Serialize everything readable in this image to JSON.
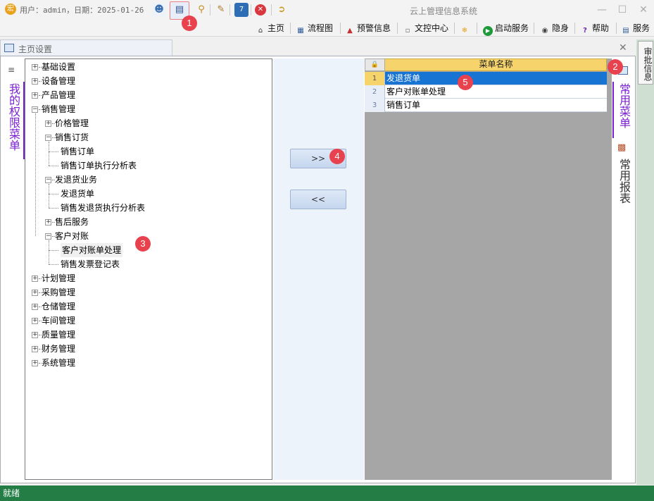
{
  "titlebar": {
    "user_info": "用户：admin，日期：2025-01-26",
    "app_title": "云上管理信息系统",
    "icon_glyph": "宏"
  },
  "navbar": {
    "items": [
      {
        "label": "主页",
        "icon": "home-icon"
      },
      {
        "label": "流程图",
        "icon": "flowchart-icon"
      },
      {
        "label": "预警信息",
        "icon": "warning-icon"
      },
      {
        "label": "文控中心",
        "icon": "document-center-icon"
      },
      {
        "label": "",
        "icon": "color-logo-icon"
      },
      {
        "label": "启动服务",
        "icon": "play-icon"
      },
      {
        "label": "隐身",
        "icon": "incognito-icon"
      },
      {
        "label": "帮助",
        "icon": "help-icon"
      },
      {
        "label": "服务",
        "icon": "service-icon"
      }
    ]
  },
  "panel": {
    "title": "主页设置"
  },
  "left_tab": {
    "label": "我的权限菜单"
  },
  "tree": {
    "nodes": [
      {
        "label": "基础设置",
        "level": 0,
        "state": "collapsed"
      },
      {
        "label": "设备管理",
        "level": 0,
        "state": "collapsed"
      },
      {
        "label": "产品管理",
        "level": 0,
        "state": "collapsed"
      },
      {
        "label": "销售管理",
        "level": 0,
        "state": "expanded"
      },
      {
        "label": "价格管理",
        "level": 1,
        "state": "collapsed"
      },
      {
        "label": "销售订货",
        "level": 1,
        "state": "expanded"
      },
      {
        "label": "销售订单",
        "level": 2,
        "state": "leaf"
      },
      {
        "label": "销售订单执行分析表",
        "level": 2,
        "state": "leaf"
      },
      {
        "label": "发退货业务",
        "level": 1,
        "state": "expanded"
      },
      {
        "label": "发退货单",
        "level": 2,
        "state": "leaf"
      },
      {
        "label": "销售发退货执行分析表",
        "level": 2,
        "state": "leaf"
      },
      {
        "label": "售后服务",
        "level": 1,
        "state": "collapsed"
      },
      {
        "label": "客户对账",
        "level": 1,
        "state": "expanded"
      },
      {
        "label": "客户对账单处理",
        "level": 2,
        "state": "leaf",
        "selected": true
      },
      {
        "label": "销售发票登记表",
        "level": 2,
        "state": "leaf"
      },
      {
        "label": "计划管理",
        "level": 0,
        "state": "collapsed"
      },
      {
        "label": "采购管理",
        "level": 0,
        "state": "collapsed"
      },
      {
        "label": "仓储管理",
        "level": 0,
        "state": "collapsed"
      },
      {
        "label": "车间管理",
        "level": 0,
        "state": "collapsed"
      },
      {
        "label": "质量管理",
        "level": 0,
        "state": "collapsed"
      },
      {
        "label": "财务管理",
        "level": 0,
        "state": "collapsed"
      },
      {
        "label": "系统管理",
        "level": 0,
        "state": "collapsed"
      }
    ]
  },
  "buttons": {
    "add_label": ">>",
    "remove_label": "<<"
  },
  "grid": {
    "column_header": "菜单名称",
    "rows": [
      {
        "num": "1",
        "name": "发退货单",
        "selected": true
      },
      {
        "num": "2",
        "name": "客户对账单处理",
        "selected": false
      },
      {
        "num": "3",
        "name": "销售订单",
        "selected": false
      }
    ]
  },
  "right_tabs": [
    {
      "label": "常用菜单",
      "icon": "grid-icon",
      "active": true
    },
    {
      "label": "常用报表",
      "icon": "bar-chart-icon",
      "active": false
    }
  ],
  "outer_tab": {
    "label": "审批信息"
  },
  "statusbar": {
    "text": "就绪"
  },
  "callouts": [
    "1",
    "2",
    "3",
    "4",
    "5"
  ],
  "colors": {
    "accent_purple": "#7a1fd1",
    "grid_header": "#f6d36b",
    "selection_blue": "#1874d2",
    "status_green": "#237d45",
    "callout_red": "#e8424f"
  }
}
